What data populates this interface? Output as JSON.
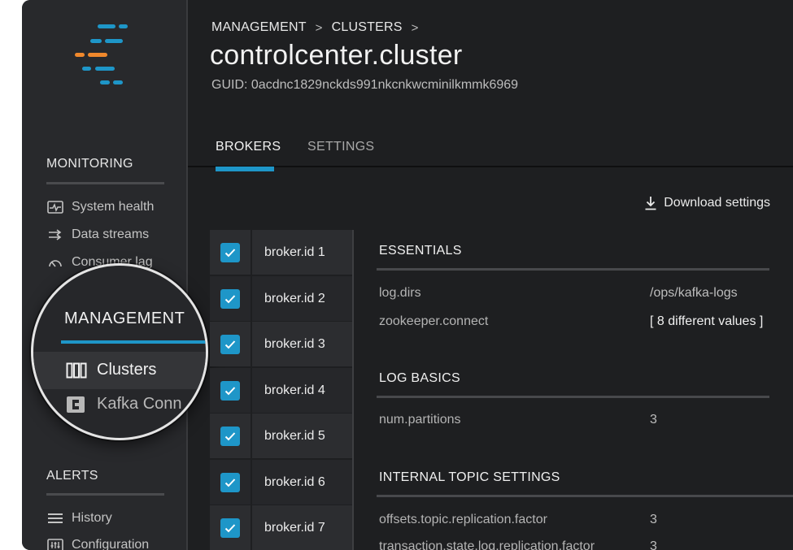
{
  "sidebar": {
    "monitoring": {
      "heading": "MONITORING",
      "items": [
        {
          "label": "System health",
          "icon": "pulse-icon"
        },
        {
          "label": "Data streams",
          "icon": "streams-icon"
        },
        {
          "label": "Consumer lag",
          "icon": "gauge-icon"
        }
      ]
    },
    "management": {
      "heading": "MANAGEMENT",
      "items": [
        {
          "label": "Clusters",
          "icon": "clusters-icon",
          "active": true
        },
        {
          "label": "Kafka Conn",
          "icon": "connect-icon"
        }
      ]
    },
    "alerts": {
      "heading": "ALERTS",
      "items": [
        {
          "label": "History",
          "icon": "menu-lines-icon"
        },
        {
          "label": "Configuration",
          "icon": "config-icon"
        }
      ]
    }
  },
  "breadcrumb": {
    "items": [
      "MANAGEMENT",
      "CLUSTERS"
    ],
    "separator": ">"
  },
  "page": {
    "title": "controlcenter.cluster",
    "guid": "GUID: 0acdnc1829nckds991nkcnkwcminilkmmk6969"
  },
  "tabs": [
    {
      "label": "BROKERS",
      "active": true
    },
    {
      "label": "SETTINGS",
      "active": false
    }
  ],
  "download_label": "Download settings",
  "brokers": [
    {
      "label": "broker.id 1",
      "checked": true
    },
    {
      "label": "broker.id 2",
      "checked": true
    },
    {
      "label": "broker.id 3",
      "checked": true
    },
    {
      "label": "broker.id 4",
      "checked": true
    },
    {
      "label": "broker.id 5",
      "checked": true
    },
    {
      "label": "broker.id 6",
      "checked": true
    },
    {
      "label": "broker.id 7",
      "checked": true
    }
  ],
  "sections": [
    {
      "title": "ESSENTIALS",
      "props": [
        {
          "key": "log.dirs",
          "value": "/ops/kafka-logs"
        },
        {
          "key": "zookeeper.connect",
          "value": "[ 8 different values ]"
        }
      ]
    },
    {
      "title": "LOG BASICS",
      "props": [
        {
          "key": "num.partitions",
          "value": "3"
        }
      ]
    },
    {
      "title": "INTERNAL TOPIC SETTINGS",
      "props": [
        {
          "key": "offsets.topic.replication.factor",
          "value": "3"
        },
        {
          "key": "transaction.state.log.replication.factor",
          "value": "3"
        }
      ]
    }
  ],
  "colors": {
    "accent": "#1e96c8",
    "logo_orange": "#f0882c",
    "background": "#1e1f21",
    "sidebar": "#28292c"
  }
}
